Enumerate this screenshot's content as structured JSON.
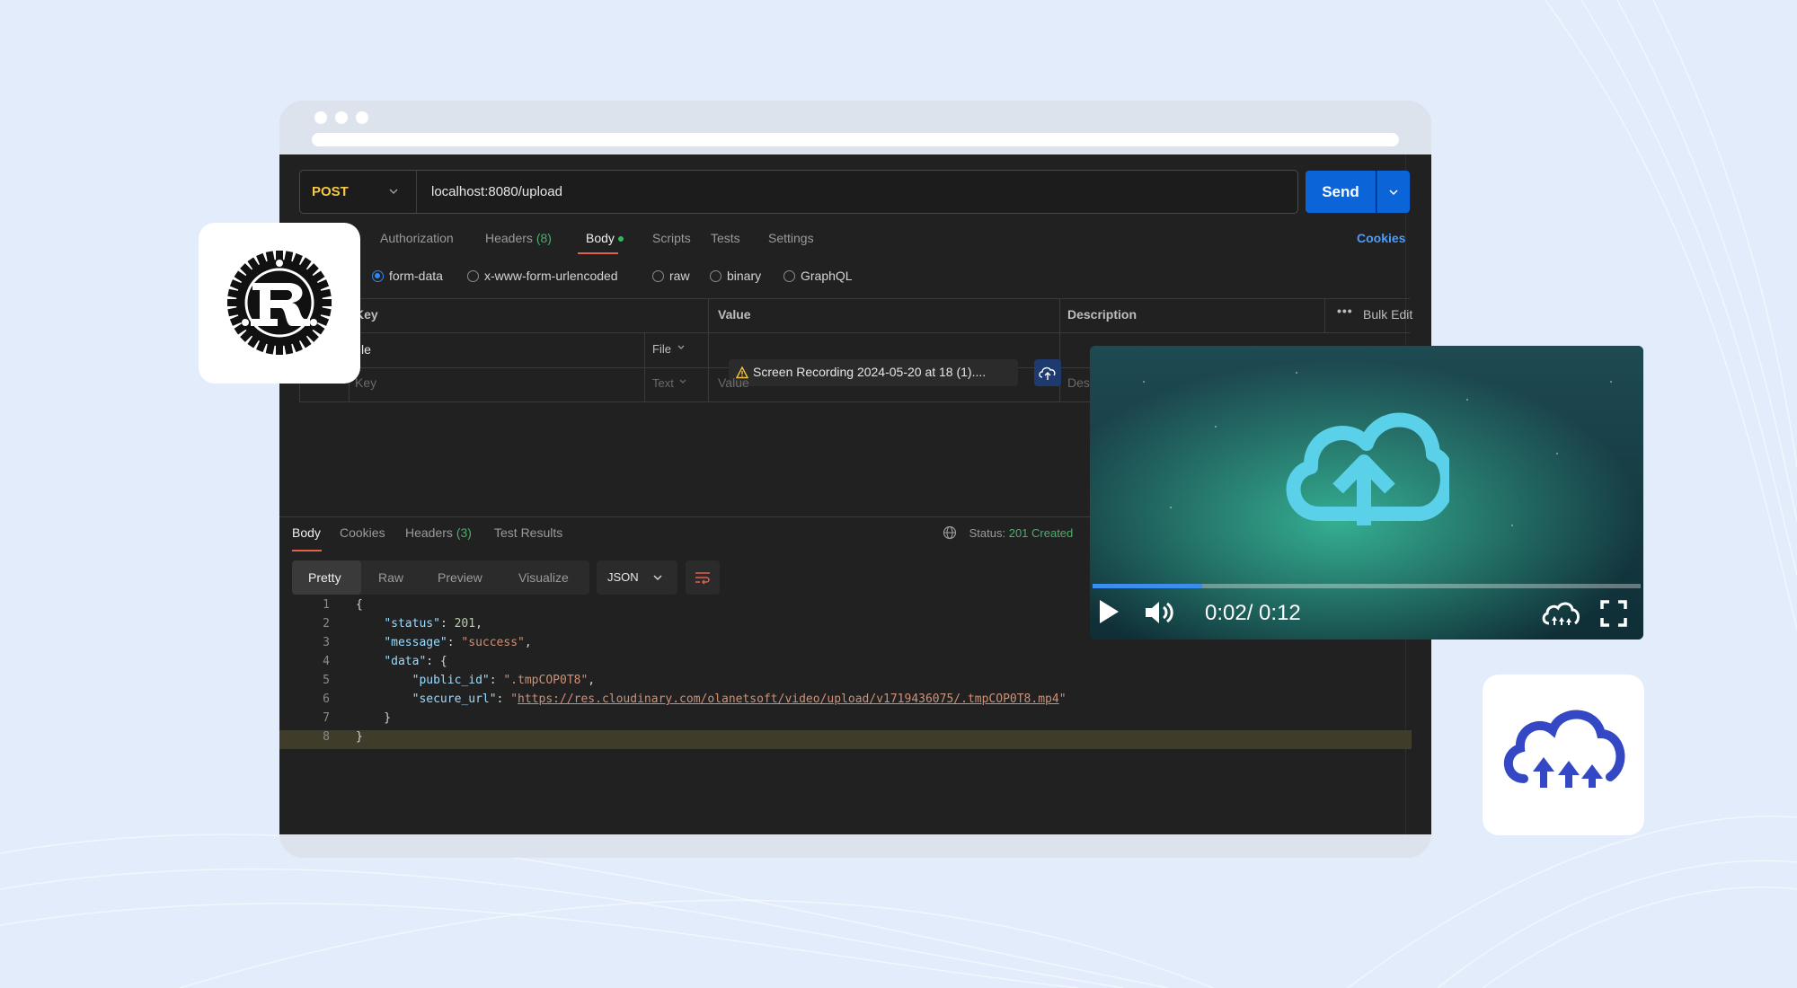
{
  "request": {
    "method": "POST",
    "url": "localhost:8080/upload",
    "send_label": "Send"
  },
  "tabs": {
    "authorization": "Authorization",
    "headers": "Headers",
    "headers_count": "(8)",
    "body": "Body",
    "scripts": "Scripts",
    "tests": "Tests",
    "settings": "Settings",
    "cookies": "Cookies"
  },
  "body_types": {
    "form_data": "form-data",
    "urlencoded": "x-www-form-urlencoded",
    "raw": "raw",
    "binary": "binary",
    "graphql": "GraphQL"
  },
  "form_table": {
    "headers": {
      "key": "Key",
      "value": "Value",
      "description": "Description",
      "bulk_edit": "Bulk Edit"
    },
    "rows": [
      {
        "key": "file",
        "type": "File",
        "value": "Screen Recording 2024-05-20 at 18 (1)...."
      },
      {
        "key_placeholder": "Key",
        "type": "Text",
        "value_placeholder": "Value",
        "description_placeholder": "Desc"
      }
    ]
  },
  "response": {
    "tabs": {
      "body": "Body",
      "cookies": "Cookies",
      "headers": "Headers",
      "headers_count": "(3)",
      "test_results": "Test Results"
    },
    "status_label": "Status:",
    "status_value": "201 Created",
    "views": {
      "pretty": "Pretty",
      "raw": "Raw",
      "preview": "Preview",
      "visualize": "Visualize"
    },
    "format": "JSON",
    "lines": [
      "1",
      "2",
      "3",
      "4",
      "5",
      "6",
      "7",
      "8"
    ],
    "json": {
      "status_key": "\"status\"",
      "status_val": "201",
      "message_key": "\"message\"",
      "message_val": "\"success\"",
      "data_key": "\"data\"",
      "public_id_key": "\"public_id\"",
      "public_id_val": "\".tmpCOP0T8\"",
      "secure_url_key": "\"secure_url\"",
      "secure_url_val": "https://res.cloudinary.com/olanetsoft/video/upload/v1719436075/.tmpCOP0T8.mp4"
    }
  },
  "video": {
    "time": "0:02/ 0:12",
    "progress_fraction": 0.2
  },
  "colors": {
    "accent_blue": "#0b64d8",
    "cloud_blue": "#3448c5",
    "upload_cyan": "#5ad1e8"
  },
  "icons": [
    "rust-logo-icon",
    "cloudinary-logo-icon",
    "cloud-upload-icon",
    "play-icon",
    "volume-icon",
    "fullscreen-icon",
    "globe-icon",
    "wrap-lines-icon",
    "warning-icon",
    "chevron-down-icon"
  ]
}
